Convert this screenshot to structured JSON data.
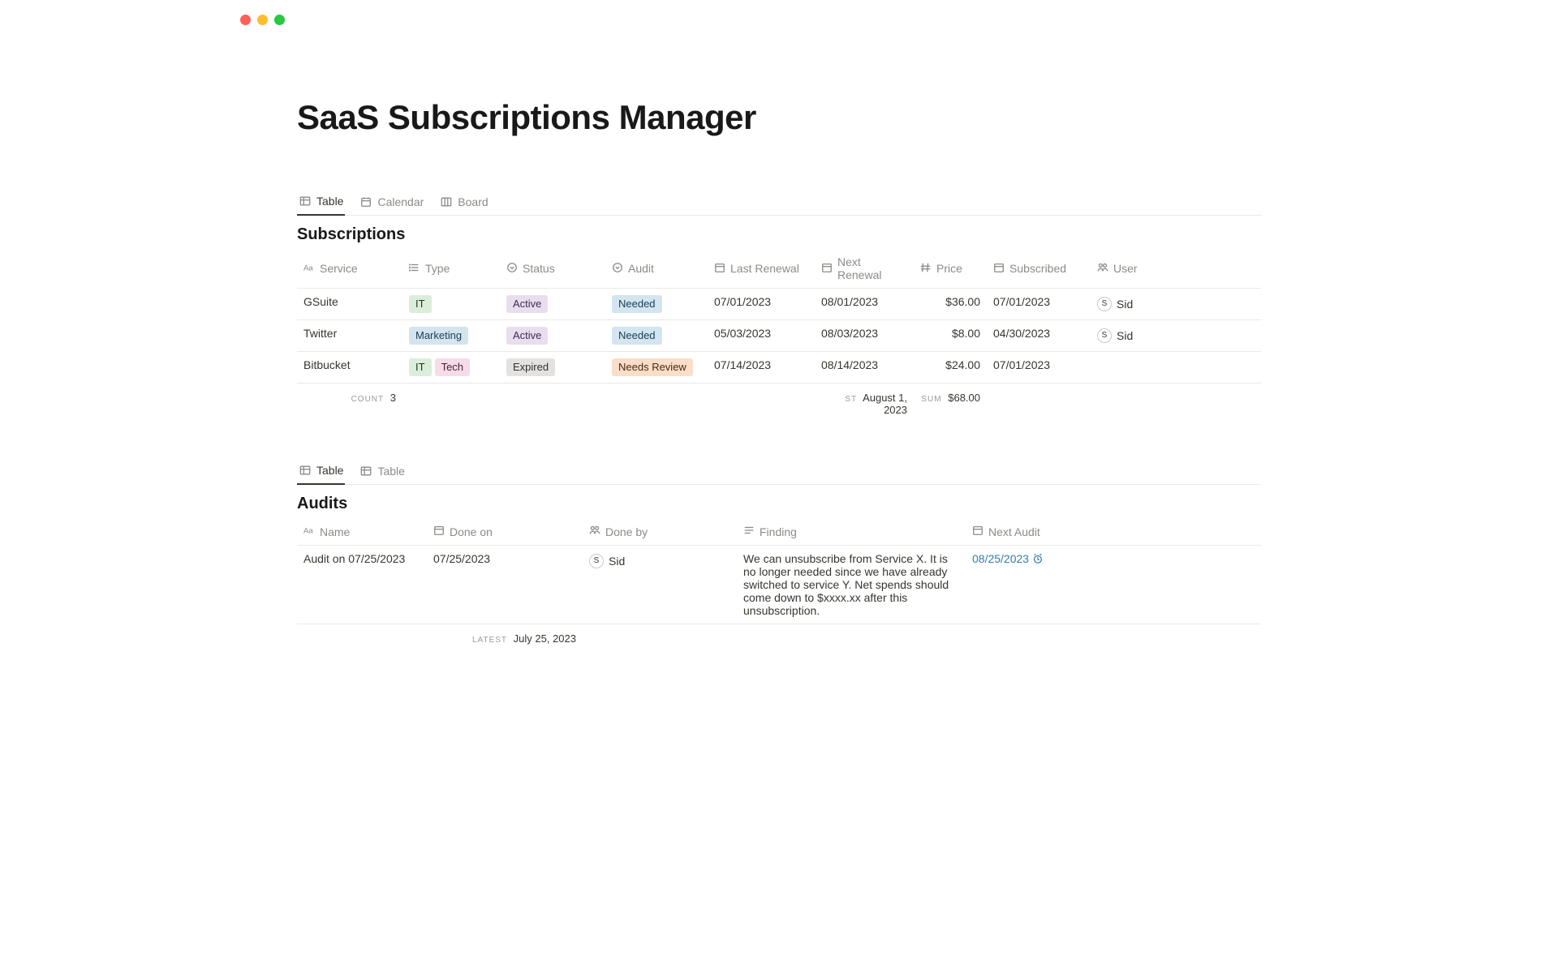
{
  "page": {
    "title": "SaaS Subscriptions Manager"
  },
  "subs_views": [
    {
      "label": "Table",
      "active": true,
      "icon": "table"
    },
    {
      "label": "Calendar",
      "active": false,
      "icon": "calendar"
    },
    {
      "label": "Board",
      "active": false,
      "icon": "board"
    }
  ],
  "subscriptions": {
    "title": "Subscriptions",
    "columns": {
      "service": "Service",
      "type": "Type",
      "status": "Status",
      "audit": "Audit",
      "last_renewal": "Last Renewal",
      "next_renewal": "Next Renewal",
      "price": "Price",
      "subscribed": "Subscribed",
      "user": "User"
    },
    "rows": [
      {
        "service": "GSuite",
        "type": [
          {
            "text": "IT",
            "color": "green"
          }
        ],
        "status": {
          "text": "Active",
          "color": "purple"
        },
        "audit": {
          "text": "Needed",
          "color": "blue"
        },
        "last_renewal": "07/01/2023",
        "next_renewal": "08/01/2023",
        "price": "$36.00",
        "subscribed": "07/01/2023",
        "user": {
          "initial": "S",
          "name": "Sid"
        }
      },
      {
        "service": "Twitter",
        "type": [
          {
            "text": "Marketing",
            "color": "blue"
          }
        ],
        "status": {
          "text": "Active",
          "color": "purple"
        },
        "audit": {
          "text": "Needed",
          "color": "blue"
        },
        "last_renewal": "05/03/2023",
        "next_renewal": "08/03/2023",
        "price": "$8.00",
        "subscribed": "04/30/2023",
        "user": {
          "initial": "S",
          "name": "Sid"
        }
      },
      {
        "service": "Bitbucket",
        "type": [
          {
            "text": "IT",
            "color": "green"
          },
          {
            "text": "Tech",
            "color": "pink"
          }
        ],
        "status": {
          "text": "Expired",
          "color": "gray"
        },
        "audit": {
          "text": "Needs Review",
          "color": "orange"
        },
        "last_renewal": "07/14/2023",
        "next_renewal": "08/14/2023",
        "price": "$24.00",
        "subscribed": "07/01/2023",
        "user": null
      }
    ],
    "summary": {
      "count_label": "COUNT",
      "count_value": "3",
      "next_renewal_label": "ST",
      "next_renewal_value": "August 1, 2023",
      "sum_label": "SUM",
      "sum_value": "$68.00"
    }
  },
  "audits_views": [
    {
      "label": "Table",
      "active": true,
      "icon": "table"
    },
    {
      "label": "Table",
      "active": false,
      "icon": "table"
    }
  ],
  "audits": {
    "title": "Audits",
    "columns": {
      "name": "Name",
      "done_on": "Done on",
      "done_by": "Done by",
      "finding": "Finding",
      "next_audit": "Next Audit"
    },
    "rows": [
      {
        "name": "Audit on 07/25/2023",
        "done_on": "07/25/2023",
        "done_by": {
          "initial": "S",
          "name": "Sid"
        },
        "finding": "We can unsubscribe from Service X. It is no longer needed since we have already switched to service Y. Net spends should come down to $xxxx.xx after this unsubscription.",
        "next_audit": "08/25/2023"
      }
    ],
    "summary": {
      "latest_label": "LATEST",
      "latest_value": "July 25, 2023"
    }
  }
}
